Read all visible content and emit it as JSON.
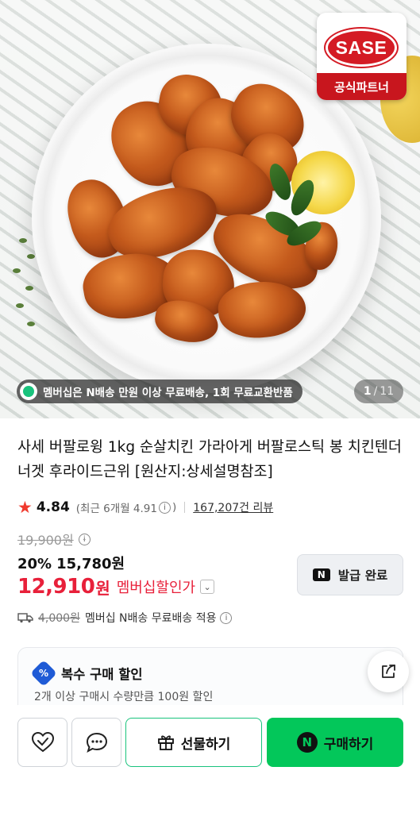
{
  "hero": {
    "badge_logo": "SASE",
    "badge_text": "공식파트너",
    "notice_text": "멤버십은 N배송 만원 이상 무료배송, 1회 무료교환반품",
    "page_current": "1",
    "page_separator": "/",
    "page_total": "11"
  },
  "product": {
    "title": "사세 버팔로윙 1kg 순살치킨 가라아게 버팔로스틱 봉 치킨텐더 너겟 후라이드근위 [원산지:상세설명참조]",
    "rating": "4.84",
    "recent_rating": "(최근 6개월 4.91",
    "recent_close": ")",
    "review_count": "167,207건 리뷰",
    "original_price": "19,900원",
    "discount_rate": "20%",
    "discount_price": "15,780원",
    "member_price": "12,910",
    "member_won": "원",
    "member_label": "멤버십할인가",
    "coupon_label": "발급 완료",
    "shipping_old": "4,000원",
    "shipping_text": "멤버십 N배송 무료배송 적용"
  },
  "multi_discount": {
    "title": "복수 구매 할인",
    "description": "2개 이상 구매시 수량만큼 100원 할인",
    "icon_text": "%"
  },
  "bottom_bar": {
    "gift_label": "선물하기",
    "buy_label": "구매하기",
    "n_logo": "N"
  },
  "icons": [
    "heart-icon",
    "chat-icon",
    "gift-icon",
    "share-icon",
    "truck-icon",
    "info-icon",
    "chevron-down-icon",
    "star-icon"
  ],
  "colors": {
    "accent_red": "#e8203a",
    "naver_green": "#03c75a",
    "sase_red": "#d41b24",
    "star": "#f03a2e"
  }
}
